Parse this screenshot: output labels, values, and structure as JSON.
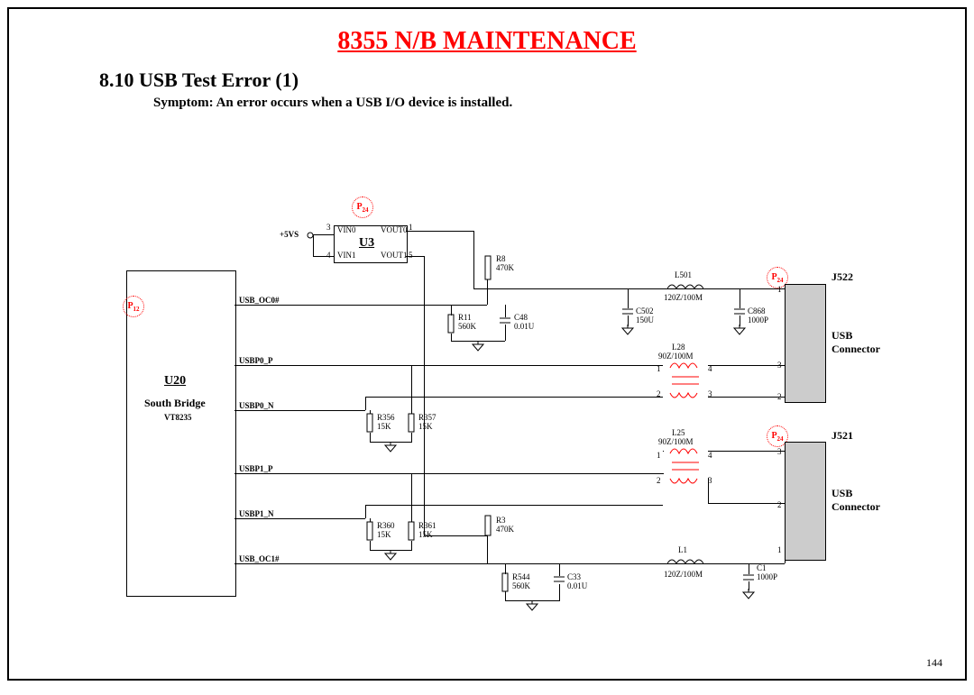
{
  "title": "8355 N/B MAINTENANCE",
  "section": "8.10 USB Test Error (1)",
  "symptom": "Symptom: An error occurs when a USB I/O device is installed.",
  "page_number": "144",
  "south_bridge": {
    "ref": "U20",
    "name": "South Bridge",
    "part": "VT8235",
    "signals": [
      "USB_OC0#",
      "USBP0_P",
      "USBP0_N",
      "USBP1_P",
      "USBP1_N",
      "USB_OC1#"
    ]
  },
  "u3": {
    "ref": "U3",
    "left_pins": {
      "3": "VIN0",
      "4": "VIN1"
    },
    "right_pins": {
      "1": "VOUT0",
      "5": "VOUT1"
    },
    "supply": "+5VS"
  },
  "p_refs": {
    "p12": "P12",
    "p24a": "P24",
    "p24b": "P24",
    "p24c": "P24"
  },
  "connectors": {
    "j522": {
      "ref": "J522",
      "label1": "USB",
      "label2": "Connector",
      "pins": [
        "1",
        "3",
        "2"
      ]
    },
    "j521": {
      "ref": "J521",
      "label1": "USB",
      "label2": "Connector",
      "pins": [
        "3",
        "2",
        "1"
      ]
    }
  },
  "components": {
    "R8": {
      "val": "470K"
    },
    "R11": {
      "val": "560K"
    },
    "C48": {
      "val": "0.01U"
    },
    "R356": {
      "val": "15K"
    },
    "R357": {
      "val": "15K"
    },
    "R360": {
      "val": "15K"
    },
    "R361": {
      "val": "15K"
    },
    "R3": {
      "val": "470K"
    },
    "R544": {
      "val": "560K"
    },
    "C33": {
      "val": "0.01U"
    },
    "L501": {
      "val": "120Z/100M"
    },
    "C502": {
      "val": "150U"
    },
    "C868": {
      "val": "1000P"
    },
    "L28": {
      "val": "90Z/100M",
      "pins": [
        "1",
        "4",
        "2",
        "3"
      ]
    },
    "L25": {
      "val": "90Z/100M",
      "pins": [
        "1",
        "4",
        "2",
        "3"
      ]
    },
    "L1": {
      "val": "120Z/100M"
    },
    "C1": {
      "val": "1000P"
    }
  }
}
